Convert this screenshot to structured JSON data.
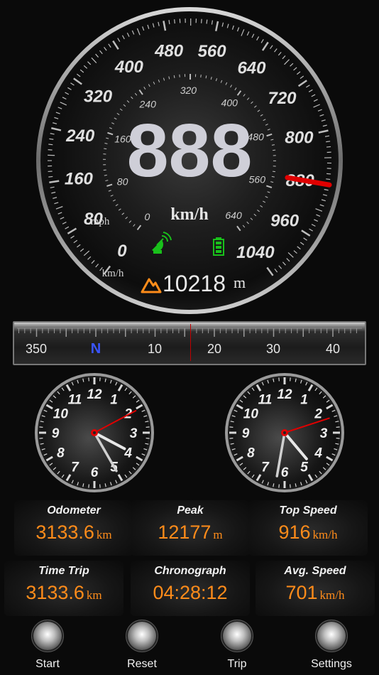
{
  "speedometer": {
    "display_speed": "888",
    "speed_unit": "km/h",
    "outer_scale": [
      "0",
      "80",
      "160",
      "240",
      "320",
      "400",
      "480",
      "560",
      "640",
      "720",
      "800",
      "880",
      "960",
      "1040"
    ],
    "inner_scale": [
      "0",
      "80",
      "160",
      "240",
      "320",
      "400",
      "480",
      "560",
      "640"
    ],
    "inner_unit": "mph",
    "outer_unit": "km/h",
    "needle_value_kmh": 880,
    "altitude": "10218",
    "altitude_unit": "m",
    "gps_icon": "satellite-dish-icon",
    "battery_icon": "battery-icon",
    "altitude_icon": "mountain-icon",
    "accent": "#ff8c1a",
    "needle_color": "#e00000",
    "status_green": "#19c01b"
  },
  "compass": {
    "labels": [
      "350",
      "N",
      "10",
      "20",
      "30",
      "40"
    ]
  },
  "clocks": [
    {
      "numerals": [
        "12",
        "1",
        "2",
        "3",
        "4",
        "5",
        "6",
        "7",
        "8",
        "9",
        "10",
        "11"
      ],
      "hour_hand_angle": 118,
      "minute_hand_angle": 150,
      "second_hand_angle": 62
    },
    {
      "numerals": [
        "12",
        "1",
        "2",
        "3",
        "4",
        "5",
        "6",
        "7",
        "8",
        "9",
        "10",
        "11"
      ],
      "hour_hand_angle": 140,
      "minute_hand_angle": 190,
      "second_hand_angle": 72
    }
  ],
  "stats": [
    {
      "title": "Odometer",
      "value": "3133.6",
      "unit": "km"
    },
    {
      "title": "Peak",
      "value": "12177",
      "unit": "m"
    },
    {
      "title": "Top Speed",
      "value": "916",
      "unit": "km/h"
    },
    {
      "title": "Time Trip",
      "value": "3133.6",
      "unit": "km"
    },
    {
      "title": "Chronograph",
      "value": "04:28:12",
      "unit": ""
    },
    {
      "title": "Avg. Speed",
      "value": "701",
      "unit": "km/h"
    }
  ],
  "toolbar": {
    "start_label": "Start",
    "reset_label": "Reset",
    "trip_label": "Trip",
    "settings_label": "Settings"
  }
}
